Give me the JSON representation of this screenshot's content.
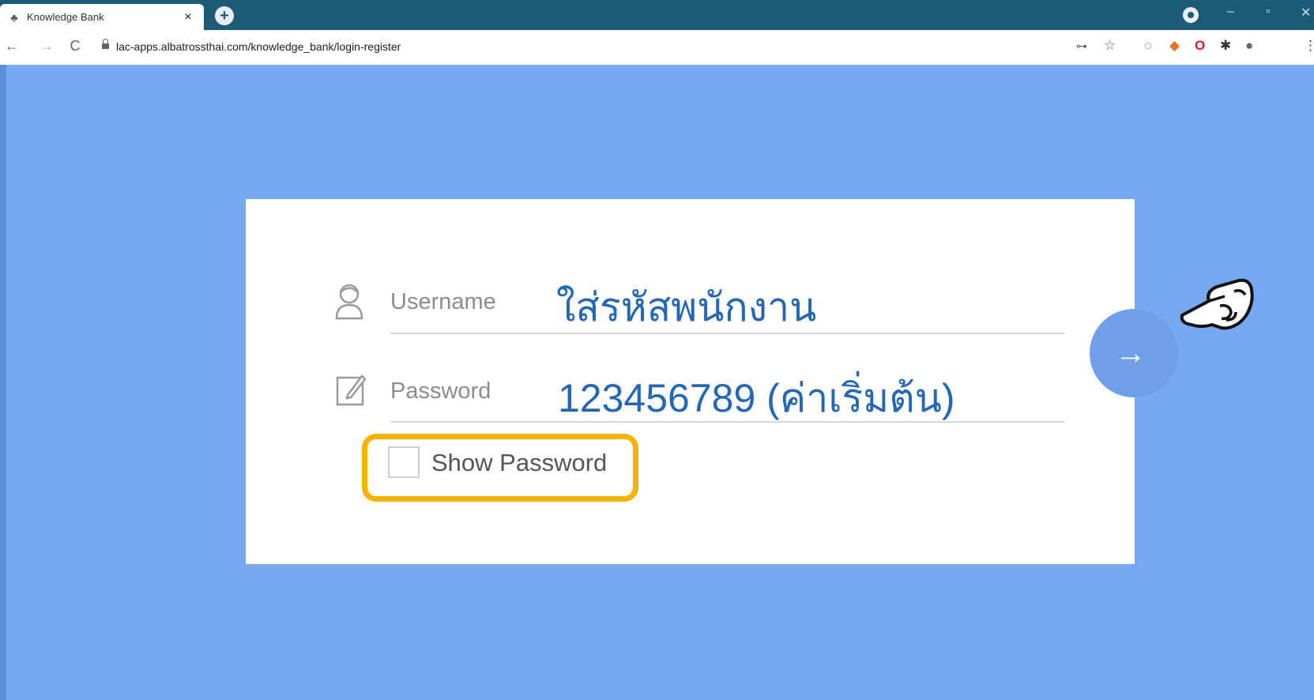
{
  "browser": {
    "tab_title": "Knowledge Bank",
    "tab_close": "×",
    "new_tab": "+",
    "url": "lac-apps.albatrossthai.com/knowledge_bank/login-register",
    "nav": {
      "back": "←",
      "forward": "→",
      "reload": "C"
    }
  },
  "login": {
    "username_label": "Username",
    "password_label": "Password",
    "show_password_label": "Show Password",
    "show_password_checked": false,
    "submit_arrow": "→"
  },
  "annotations": {
    "username_note": "ใส่รหัสพนักงาน",
    "password_note": "123456789 (ค่าเริ่มต้น)",
    "highlight_color": "#f5b400"
  },
  "colors": {
    "page_background": "#76a8f3",
    "tabstrip": "#1c5a76",
    "note_text": "#2567b3"
  }
}
